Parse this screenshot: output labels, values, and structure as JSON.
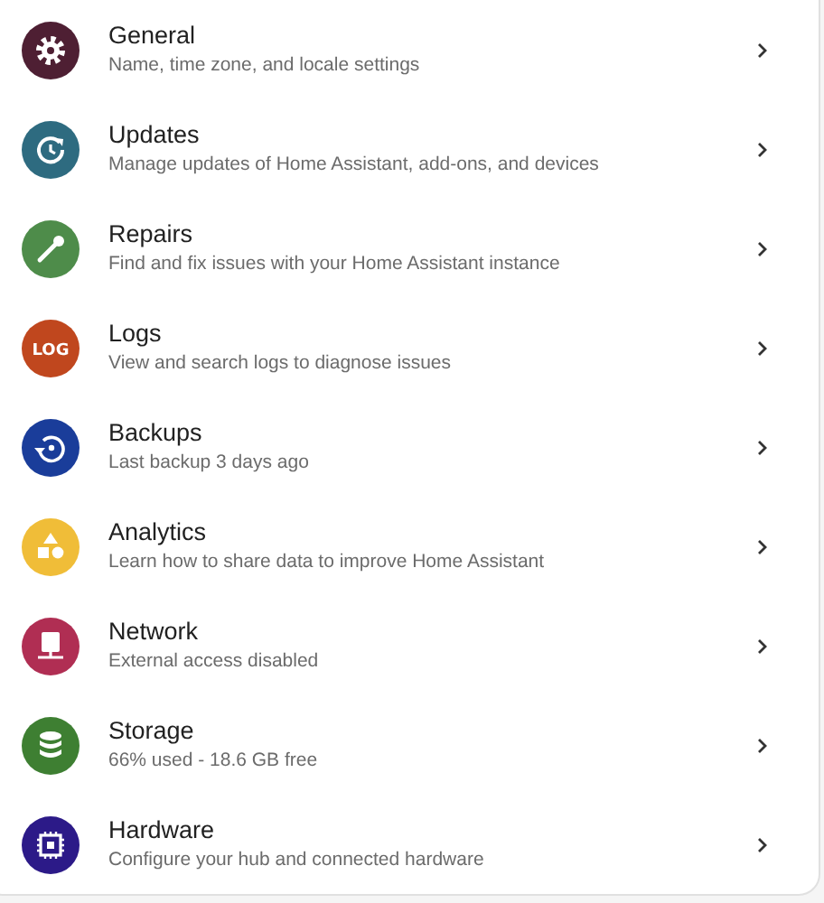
{
  "items": [
    {
      "kind": "gear",
      "color": "#4e1f33",
      "title": "General",
      "subtitle": "Name, time zone, and locale settings"
    },
    {
      "kind": "update",
      "color": "#2e6b80",
      "title": "Updates",
      "subtitle": "Manage updates of Home Assistant, add-ons, and devices"
    },
    {
      "kind": "wrench",
      "color": "#4e8c4a",
      "title": "Repairs",
      "subtitle": "Find and fix issues with your Home Assistant instance"
    },
    {
      "kind": "log",
      "color": "#c0471e",
      "icon_text": "LOG",
      "title": "Logs",
      "subtitle": "View and search logs to diagnose issues"
    },
    {
      "kind": "backup",
      "color": "#1a3d9a",
      "title": "Backups",
      "subtitle": "Last backup 3 days ago"
    },
    {
      "kind": "shapes",
      "color": "#f0bd38",
      "title": "Analytics",
      "subtitle": "Learn how to share data to improve Home Assistant"
    },
    {
      "kind": "network",
      "color": "#b02e53",
      "title": "Network",
      "subtitle": "External access disabled"
    },
    {
      "kind": "database",
      "color": "#3e7f32",
      "title": "Storage",
      "subtitle": "66% used - 18.6 GB free"
    },
    {
      "kind": "chip",
      "color": "#2c1a88",
      "title": "Hardware",
      "subtitle": "Configure your hub and connected hardware"
    }
  ]
}
